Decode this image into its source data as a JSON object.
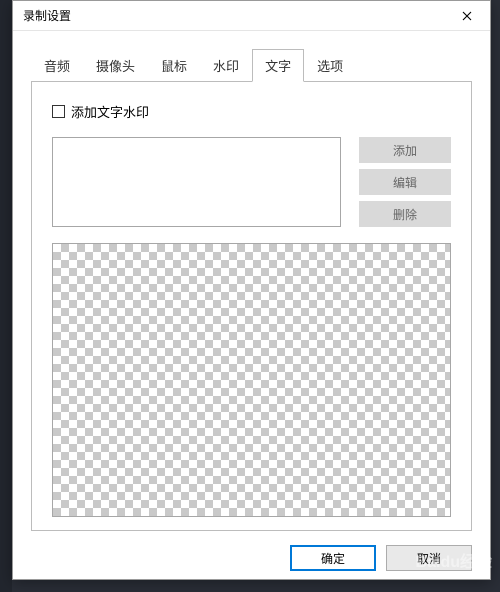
{
  "dialog": {
    "title": "录制设置"
  },
  "tabs": {
    "items": [
      {
        "label": "音频"
      },
      {
        "label": "摄像头"
      },
      {
        "label": "鼠标"
      },
      {
        "label": "水印"
      },
      {
        "label": "文字"
      },
      {
        "label": "选项"
      }
    ],
    "active_index": 4
  },
  "text_watermark": {
    "checkbox_label": "添加文字水印",
    "checked": false,
    "buttons": {
      "add": "添加",
      "edit": "编辑",
      "delete": "删除"
    }
  },
  "dialog_buttons": {
    "ok": "确定",
    "cancel": "取消"
  },
  "site_watermark": "Baidu经验"
}
